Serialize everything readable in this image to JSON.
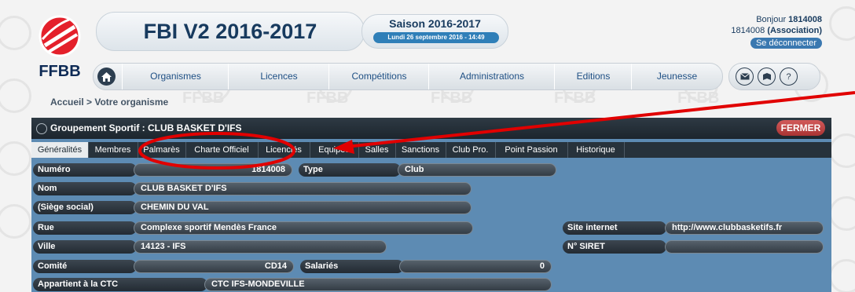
{
  "watermark": {
    "text": "FFBB"
  },
  "logo": {
    "text": "FFBB"
  },
  "header": {
    "title": "FBI V2 2016-2017",
    "saison_title": "Saison 2016-2017",
    "saison_date": "Lundi 26 septembre 2016 - 14:49"
  },
  "user": {
    "greeting": "Bonjour",
    "id": "1814008",
    "assoc_id": "1814008",
    "assoc_label": "(Association)",
    "logout": "Se déconnecter"
  },
  "nav": {
    "items": [
      "Organismes",
      "Licences",
      "Compétitions",
      "Administrations",
      "Editions",
      "Jeunesse"
    ],
    "icons": [
      "mail-icon",
      "book-icon",
      "help-icon"
    ],
    "help_glyph": "?"
  },
  "breadcrumb": "Accueil > Votre organisme",
  "panel": {
    "title": "Groupement Sportif : CLUB BASKET D'IFS",
    "close": "FERMER"
  },
  "tabs": [
    "Généralités",
    "Membres",
    "Palmarès",
    "Charte Officiel",
    "Licenciés",
    "Equipes",
    "Salles",
    "Sanctions",
    "Club Pro.",
    "Point Passion",
    "Historique"
  ],
  "fields": {
    "numero": {
      "label": "Numéro",
      "value": "1814008"
    },
    "type": {
      "label": "Type",
      "value": "Club"
    },
    "nom": {
      "label": "Nom",
      "value": "CLUB BASKET D'IFS"
    },
    "siege": {
      "label": "(Siège social)",
      "value": "CHEMIN DU VAL"
    },
    "rue": {
      "label": "Rue",
      "value": "Complexe sportif Mendès France"
    },
    "ville": {
      "label": "Ville",
      "value": "14123 - IFS"
    },
    "comite": {
      "label": "Comité",
      "value": "CD14"
    },
    "salaries": {
      "label": "Salariés",
      "value": "0"
    },
    "ctc": {
      "label": "Appartient à la CTC",
      "value": "CTC IFS-MONDEVILLE"
    },
    "site": {
      "label": "Site internet",
      "value": "http://www.clubbasketifs.fr"
    },
    "siret": {
      "label": "N° SIRET",
      "value": ""
    }
  },
  "colors": {
    "accent": "#173a5e",
    "panel_bg": "#5d8bb3",
    "close_button": "#b83a3a",
    "annotation_red": "#e10000"
  }
}
